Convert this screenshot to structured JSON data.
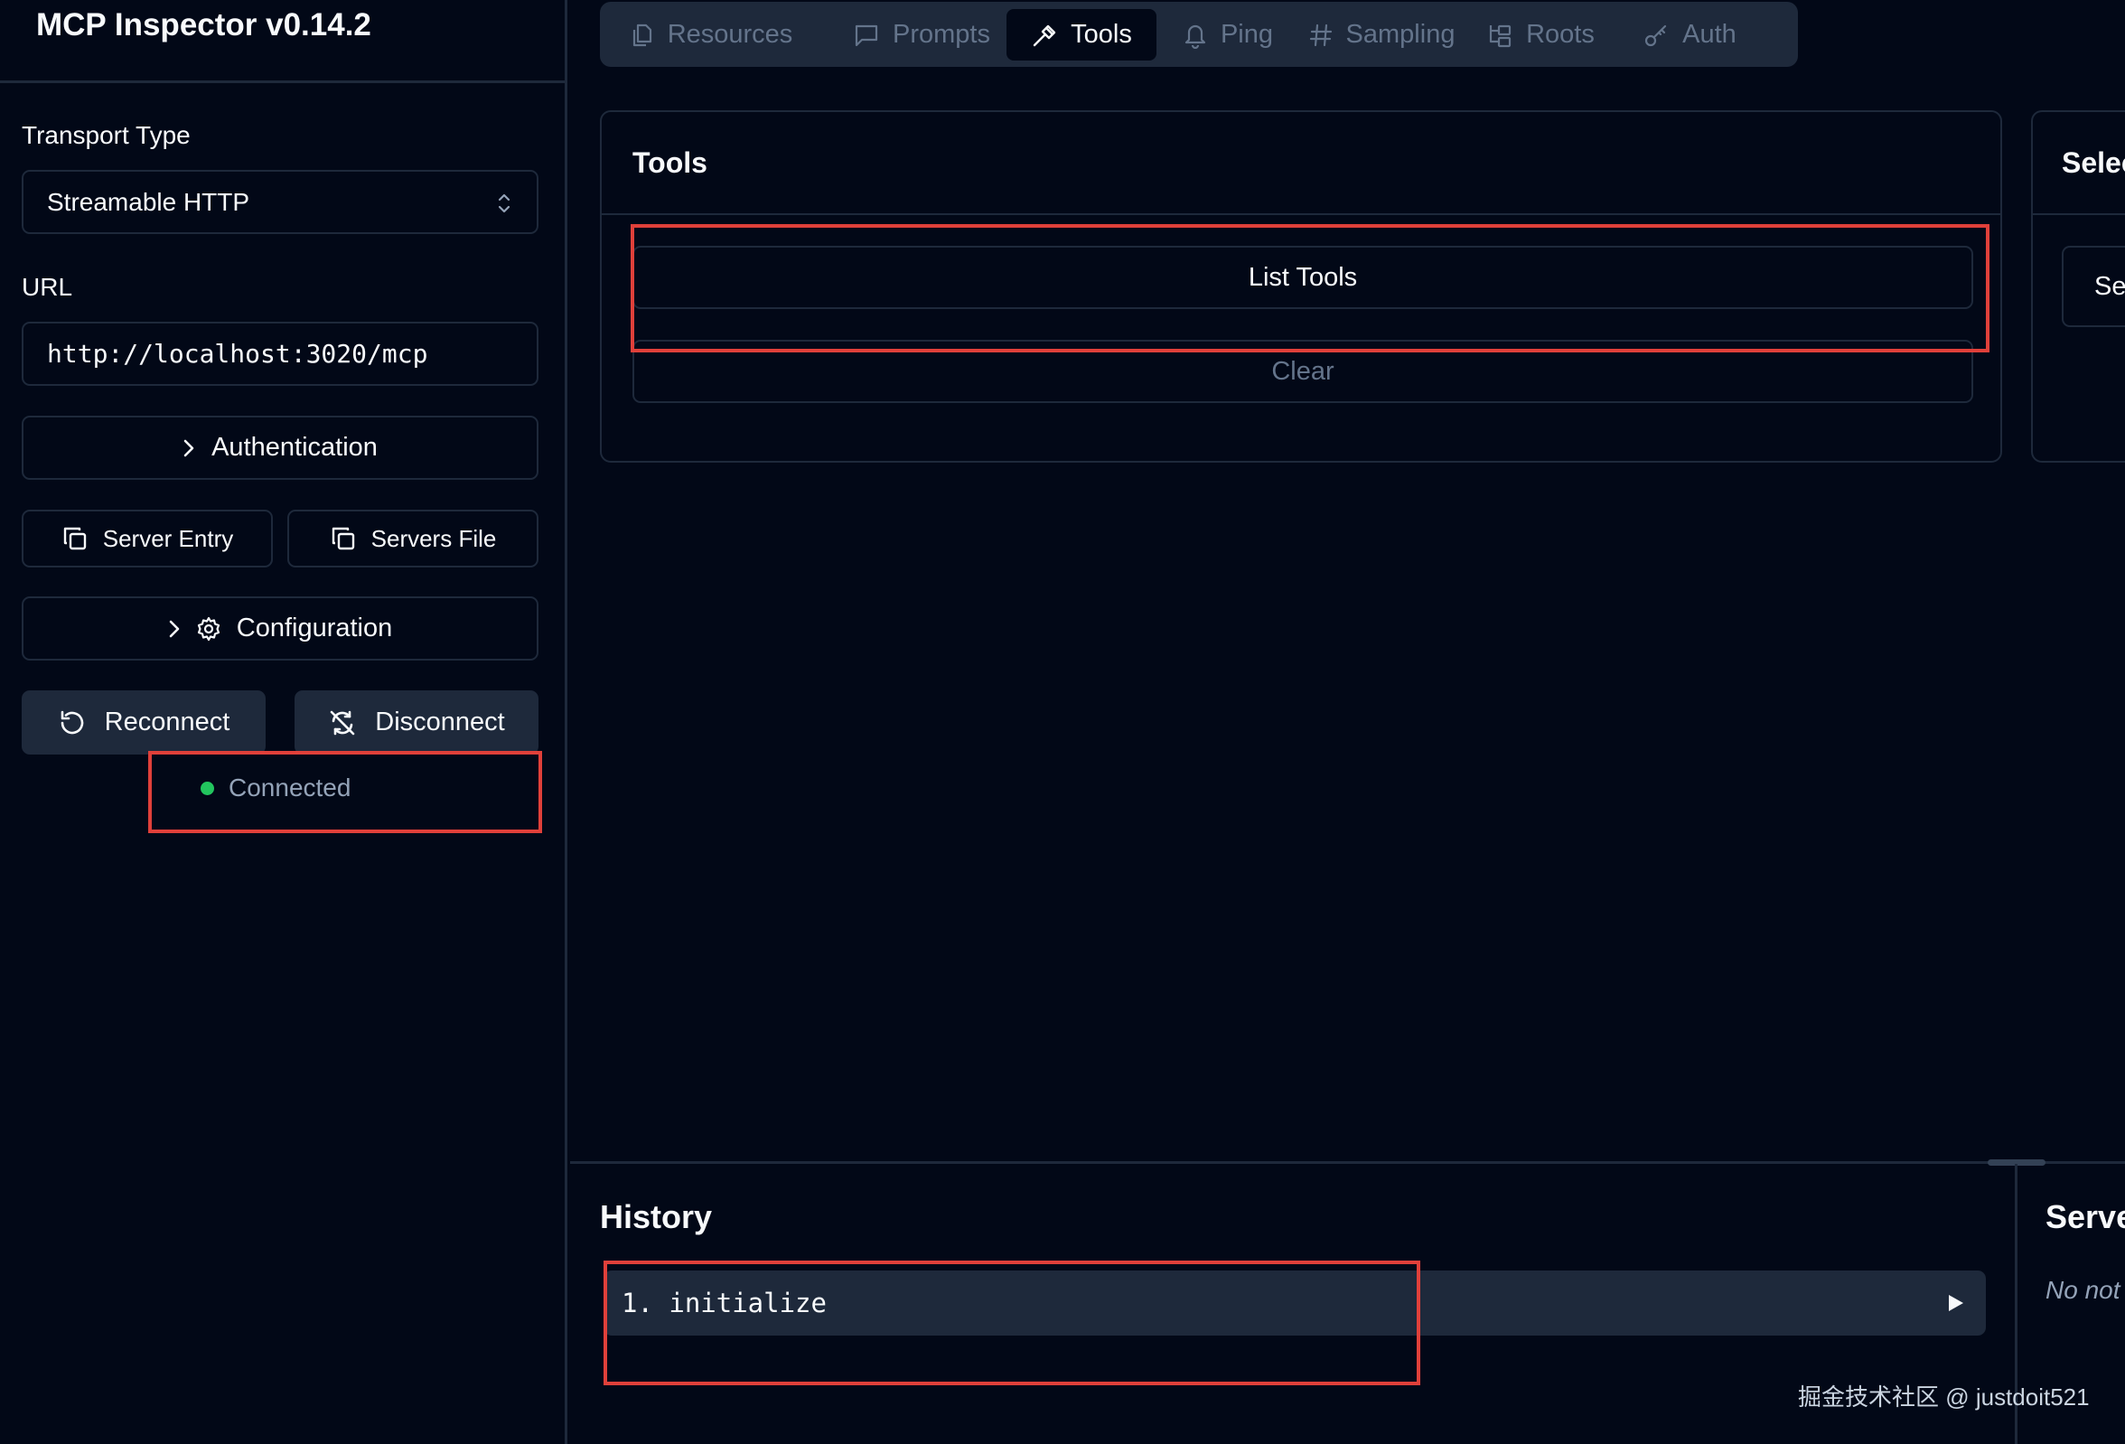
{
  "app": {
    "title": "MCP Inspector v0.14.2"
  },
  "sidebar": {
    "transport_label": "Transport Type",
    "transport_value": "Streamable HTTP",
    "url_label": "URL",
    "url_value": "http://localhost:3020/mcp",
    "authentication_label": "Authentication",
    "server_entry_label": "Server Entry",
    "servers_file_label": "Servers File",
    "configuration_label": "Configuration",
    "reconnect_label": "Reconnect",
    "disconnect_label": "Disconnect",
    "status_text": "Connected",
    "status_color": "#22c55e"
  },
  "tabs": [
    {
      "label": "Resources",
      "icon": "files-icon"
    },
    {
      "label": "Prompts",
      "icon": "message-square-icon"
    },
    {
      "label": "Tools",
      "icon": "hammer-icon",
      "active": true
    },
    {
      "label": "Ping",
      "icon": "bell-icon"
    },
    {
      "label": "Sampling",
      "icon": "hash-icon"
    },
    {
      "label": "Roots",
      "icon": "folder-tree-icon"
    },
    {
      "label": "Auth",
      "icon": "key-icon"
    }
  ],
  "tools_panel": {
    "title": "Tools",
    "list_button": "List Tools",
    "clear_button": "Clear"
  },
  "select_panel": {
    "title_partial": "Selec",
    "button_partial": "Se"
  },
  "history": {
    "title": "History",
    "items": [
      {
        "label": "1. initialize"
      }
    ]
  },
  "server_notifications": {
    "title_partial": "Serve",
    "empty_partial": "No not"
  },
  "watermark": "掘金技术社区 @ justdoit521",
  "colors": {
    "background": "#020817",
    "border": "#1e293b",
    "muted": "#64748b",
    "highlight": "#e0403a"
  }
}
